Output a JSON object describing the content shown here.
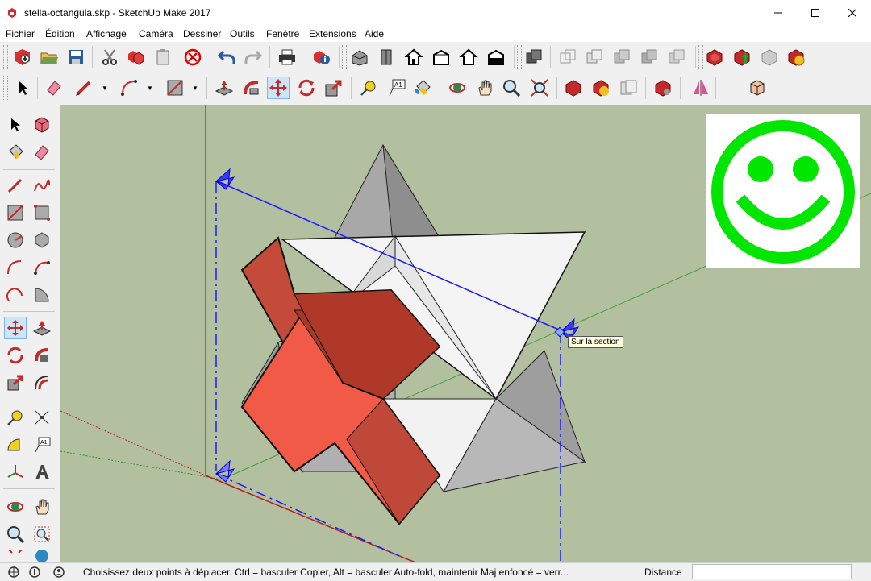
{
  "window": {
    "title": "stella-octangula.skp - SketchUp Make 2017",
    "controls": {
      "minimize": "minimize",
      "maximize": "maximize",
      "close": "close"
    }
  },
  "menu": [
    "Fichier",
    "Édition",
    "Affichage",
    "Caméra",
    "Dessiner",
    "Outils",
    "Fenêtre",
    "Extensions",
    "Aide"
  ],
  "toolbar_main": [
    "new-model-icon",
    "open-folder-icon",
    "save-icon",
    "cut-icon",
    "copy-icon",
    "paste-icon",
    "erase-delete-icon",
    "undo-icon",
    "redo-icon",
    "print-icon",
    "model-info-icon",
    "iso-view-icon",
    "top-view-icon",
    "front-view-icon",
    "right-view-icon",
    "back-view-icon",
    "left-view-icon",
    "xray-icon",
    "wireframe-icon",
    "hidden-line-icon",
    "shaded-icon",
    "shaded-texture-icon",
    "monochrome-icon",
    "warehouse-icon",
    "share-model-icon",
    "warehouse-components-icon",
    "extension-warehouse-icon"
  ],
  "toolbar_tools": [
    "select-icon",
    "eraser-icon",
    "pencil-line-icon",
    "arc-icon",
    "rectangle-icon",
    "push-pull-icon",
    "follow-me-icon",
    "move-icon",
    "rotate-icon",
    "scale-icon",
    "tape-measure-icon",
    "text-icon",
    "paint-bucket-icon",
    "orbit-icon",
    "pan-icon",
    "zoom-icon",
    "zoom-extents-icon",
    "warehouse-icon",
    "share-model-icon",
    "layout-send-icon",
    "extension-manager-icon",
    "section-plane-icon",
    "component-icon"
  ],
  "active_tool": "move",
  "viewport": {
    "tooltip": "Sur la section",
    "background_color": "#b3c0a0",
    "logo": "smiley-logo"
  },
  "status": {
    "hint": "Choisissez deux points à déplacer.  Ctrl = basculer Copier, Alt = basculer Auto-fold, maintenir Maj enfoncé = verr...",
    "measure_label": "Distance",
    "measure_value": ""
  },
  "colors": {
    "section_plane": "#1a1aff",
    "section_fill": "#c44a3a",
    "smiley": "#00e600",
    "axis_green": "#3ca03c",
    "axis_red": "#b02020"
  }
}
